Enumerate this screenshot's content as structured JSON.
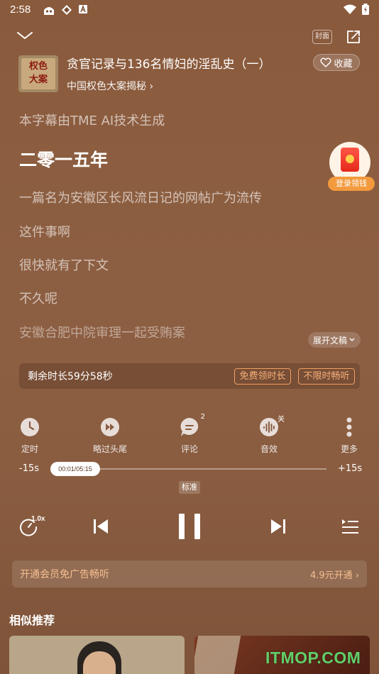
{
  "status_bar": {
    "time": "2:58"
  },
  "header": {
    "cover_label": "封面"
  },
  "track": {
    "art_text_line1": "权色",
    "art_text_line2": "大案",
    "title": "贪官记录与136名情妇的淫乱史（一）",
    "album": "中国权色大案揭秘",
    "favorite_label": "收藏"
  },
  "lyrics": {
    "notice": "本字幕由TME AI技术生成",
    "lines": [
      {
        "text": "二零一五年",
        "state": "active"
      },
      {
        "text": "一篇名为安徽区长风流日记的网帖广为流传",
        "state": "normal"
      },
      {
        "text": "这件事啊",
        "state": "normal"
      },
      {
        "text": "很快就有了下文",
        "state": "normal"
      },
      {
        "text": "不久呢",
        "state": "normal"
      },
      {
        "text": "安徽合肥中院审理一起受贿案",
        "state": "faded"
      }
    ],
    "expand_label": "展开文稿"
  },
  "promo": {
    "label": "登录领钱"
  },
  "remaining": {
    "text": "剩余时长59分58秒",
    "free_label": "免费领时长",
    "unlimited_label": "不限时畅听"
  },
  "functions": [
    {
      "label": "定时",
      "icon": "clock-icon",
      "badge": ""
    },
    {
      "label": "略过头尾",
      "icon": "skip-intro-icon",
      "badge": ""
    },
    {
      "label": "评论",
      "icon": "comment-icon",
      "badge": "2"
    },
    {
      "label": "音效",
      "icon": "sound-effect-icon",
      "badge": "关"
    },
    {
      "label": "更多",
      "icon": "more-icon",
      "badge": ""
    }
  ],
  "progress": {
    "back_label": "-15s",
    "forward_label": "+15s",
    "time_label": "00:01/05:15",
    "fraction": 0.003,
    "quality": "标准"
  },
  "controls": {
    "speed": "1.0x"
  },
  "vip": {
    "text": "开通会员免广告畅听",
    "price": "4.9元开通"
  },
  "recommend": {
    "title": "相似推荐"
  },
  "watermark": "ITMOP.COM",
  "colors": {
    "accent": "#f6b07a",
    "vip": "#f4c08f",
    "background": "#8a5d41"
  }
}
